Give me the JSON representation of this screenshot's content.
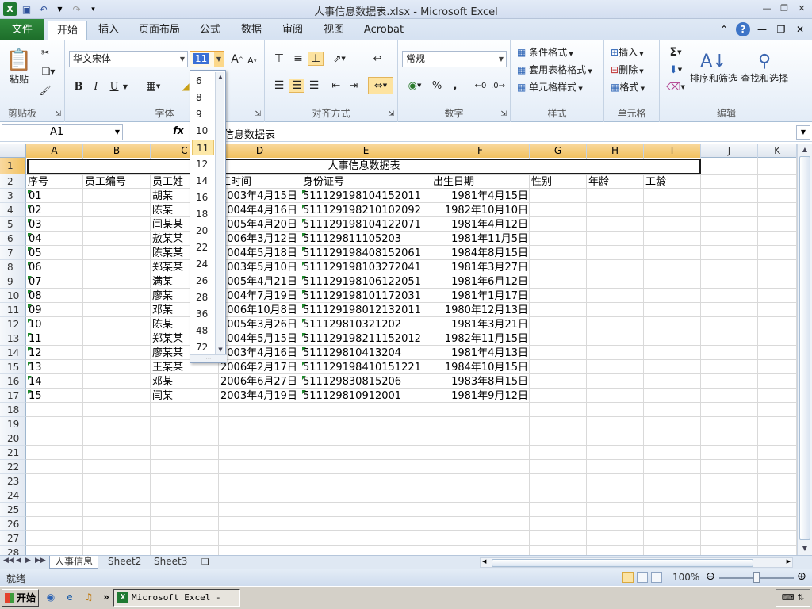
{
  "window": {
    "title": "人事信息数据表.xlsx  -  Microsoft Excel"
  },
  "ribbon": {
    "file_tab": "文件",
    "tabs": [
      "开始",
      "插入",
      "页面布局",
      "公式",
      "数据",
      "审阅",
      "视图",
      "Acrobat"
    ],
    "font_name": "华文宋体",
    "font_size": "11",
    "number_format": "常规",
    "labels": {
      "paste": "粘贴",
      "clipboard": "剪贴板",
      "font": "字体",
      "alignment": "对齐方式",
      "number": "数字",
      "styles": "样式",
      "cells": "单元格",
      "editing": "编辑",
      "conditional_format": "条件格式",
      "format_as_table": "套用表格格式",
      "cell_styles": "单元格样式",
      "insert": "插入",
      "delete": "删除",
      "format": "格式",
      "sort_filter": "排序和筛选",
      "find_select": "查找和选择",
      "bold": "B",
      "italic": "I",
      "underline": "U",
      "percent": "%",
      "comma": ",",
      "sigma": "Σ"
    }
  },
  "formula_bar": {
    "name_box": "A1",
    "fx": "fx",
    "content": "信息数据表"
  },
  "font_size_dropdown": {
    "items": [
      "6",
      "8",
      "9",
      "10",
      "11",
      "12",
      "14",
      "16",
      "18",
      "20",
      "22",
      "24",
      "26",
      "28",
      "36",
      "48",
      "72"
    ],
    "selected": "11"
  },
  "columns": [
    "A",
    "B",
    "C",
    "D",
    "E",
    "F",
    "G",
    "H",
    "I",
    "J",
    "K"
  ],
  "rows": [
    "1",
    "2",
    "3",
    "4",
    "5",
    "6",
    "7",
    "8",
    "9",
    "10",
    "11",
    "12",
    "13",
    "14",
    "15",
    "16",
    "17",
    "18",
    "19",
    "20",
    "21",
    "22",
    "23",
    "24",
    "25",
    "26",
    "27",
    "28"
  ],
  "sheet": {
    "title": "人事信息数据表",
    "headers": [
      "序号",
      "员工编号",
      "员工姓",
      "工时间",
      "身份证号",
      "出生日期",
      "性别",
      "年龄",
      "工龄"
    ],
    "records": [
      {
        "seq": "01",
        "name": "胡某",
        "date": "2003年4月15日",
        "id": "511129198104152011",
        "birth": "1981年4月15日"
      },
      {
        "seq": "02",
        "name": "陈某",
        "date": "2004年4月16日",
        "id": "511129198210102092",
        "birth": "1982年10月10日"
      },
      {
        "seq": "03",
        "name": "闫某某",
        "date": "2005年4月20日",
        "id": "511129198104122071",
        "birth": "1981年4月12日"
      },
      {
        "seq": "04",
        "name": "敖某某",
        "date": "2006年3月12日",
        "id": "511129811105203",
        "birth": "1981年11月5日"
      },
      {
        "seq": "05",
        "name": "陈某某",
        "date": "2004年5月18日",
        "id": "511129198408152061",
        "birth": "1984年8月15日"
      },
      {
        "seq": "06",
        "name": "郑某某",
        "date": "2003年5月10日",
        "id": "511129198103272041",
        "birth": "1981年3月27日"
      },
      {
        "seq": "07",
        "name": "满某",
        "date": "2005年4月21日",
        "id": "511129198106122051",
        "birth": "1981年6月12日"
      },
      {
        "seq": "08",
        "name": "廖某",
        "date": "2004年7月19日",
        "id": "511129198101172031",
        "birth": "1981年1月17日"
      },
      {
        "seq": "09",
        "name": "邓某",
        "date": "2006年10月8日",
        "id": "511129198012132011",
        "birth": "1980年12月13日"
      },
      {
        "seq": "10",
        "name": "陈某",
        "date": "2005年3月26日",
        "id": "511129810321202",
        "birth": "1981年3月21日"
      },
      {
        "seq": "11",
        "name": "郑某某",
        "date": "2004年5月15日",
        "id": "511129198211152012",
        "birth": "1982年11月15日"
      },
      {
        "seq": "12",
        "name": "廖某某",
        "date": "2003年4月16日",
        "id": "511129810413204",
        "birth": "1981年4月13日"
      },
      {
        "seq": "13",
        "name": "王某某",
        "date": "2006年2月17日",
        "id": "511129198410151221",
        "birth": "1984年10月15日"
      },
      {
        "seq": "14",
        "name": "邓某",
        "date": "2006年6月27日",
        "id": "511129830815206",
        "birth": "1983年8月15日"
      },
      {
        "seq": "15",
        "name": "闫某",
        "date": "2003年4月19日",
        "id": "511129810912001",
        "birth": "1981年9月12日"
      }
    ]
  },
  "sheet_tabs": [
    "人事信息",
    "Sheet2",
    "Sheet3"
  ],
  "status": {
    "ready": "就绪",
    "zoom": "100%"
  },
  "taskbar": {
    "start": "开始",
    "window_item": "Microsoft Excel - ..."
  },
  "colors": {
    "accent_green": "#1d6d2a",
    "selection": "#f1c15f"
  }
}
